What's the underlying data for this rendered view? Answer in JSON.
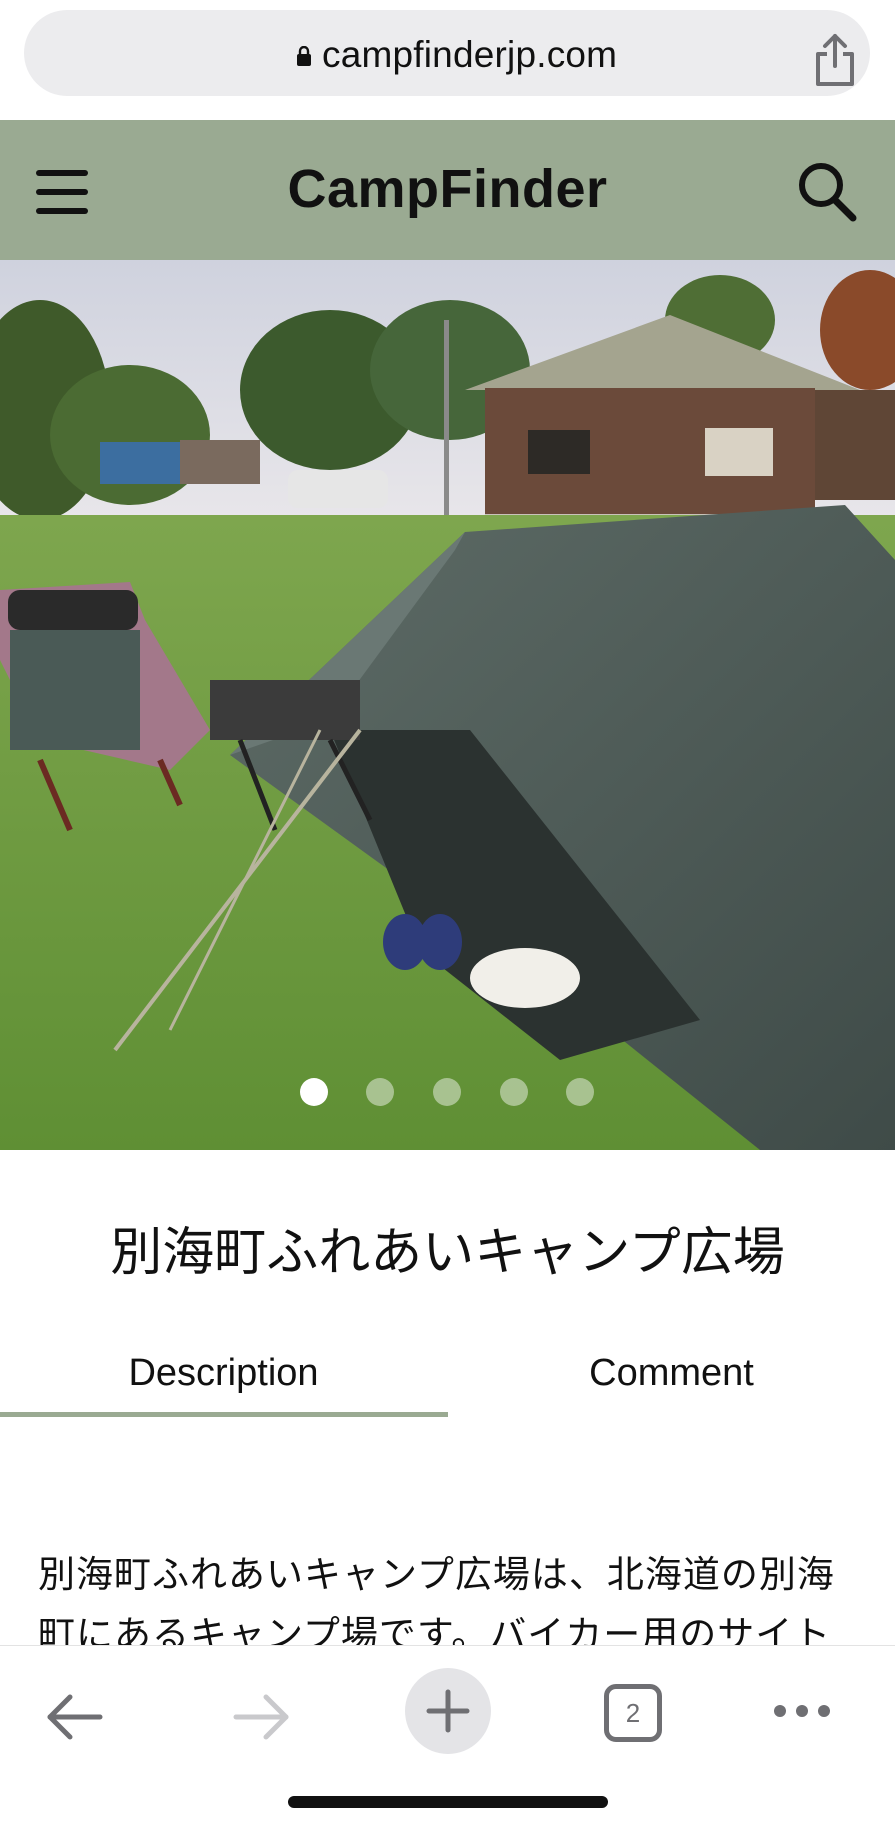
{
  "browser": {
    "url": "campfinderjp.com",
    "open_tabs_count": "2"
  },
  "header": {
    "brand": "CampFinder"
  },
  "hero": {
    "slide_count": 5,
    "active_slide": 1
  },
  "site": {
    "title": "別海町ふれあいキャンプ広場"
  },
  "tabs": [
    {
      "label": "Description",
      "active": true
    },
    {
      "label": "Comment",
      "active": false
    }
  ],
  "description": {
    "text": "別海町ふれあいキャンプ広場は、北海道の別海町にあるキャンプ場です。バイカー用のサイト"
  },
  "colors": {
    "header_bg": "#9aaa92",
    "tab_underline": "#9aaa92"
  }
}
